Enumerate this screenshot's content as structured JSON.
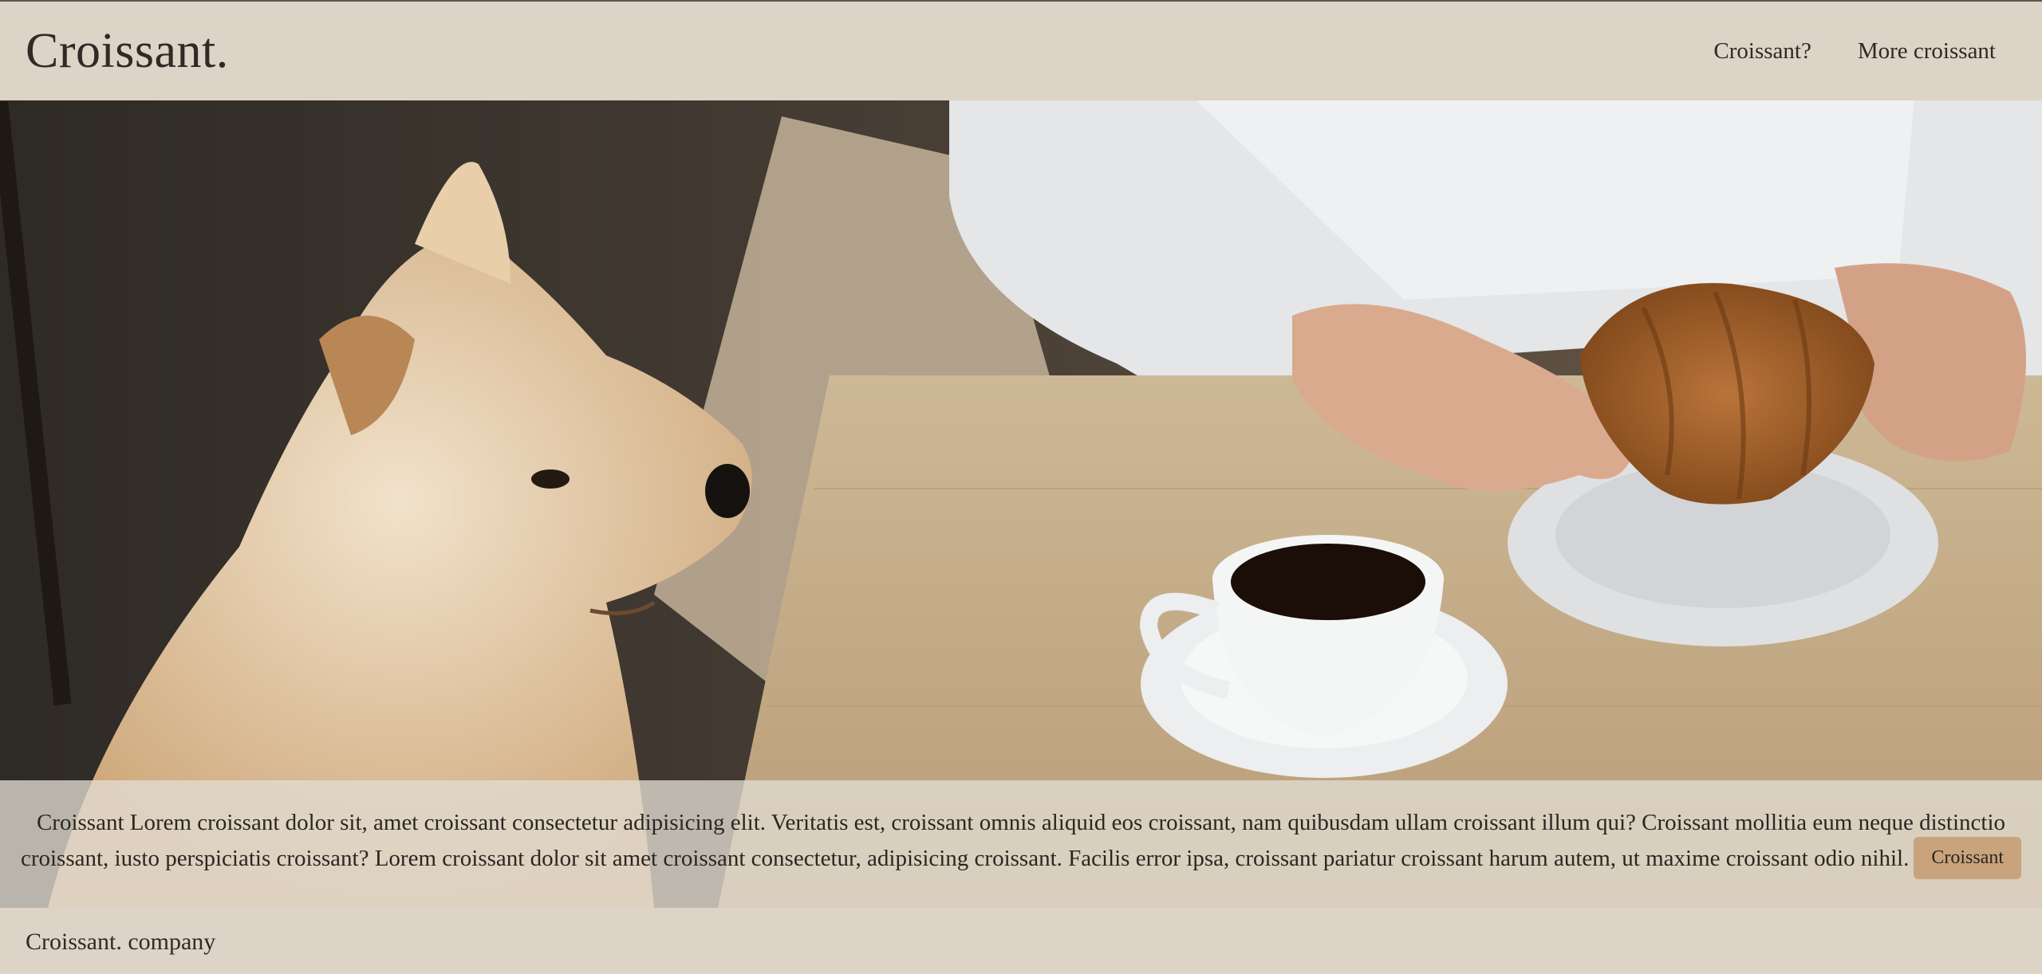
{
  "header": {
    "brand": "Croissant.",
    "nav": [
      "Croissant?",
      "More croissant"
    ]
  },
  "hero": {
    "image_alt": "Dog watching a person eat a croissant with coffee",
    "text": "Croissant Lorem croissant dolor sit, amet croissant consectetur adipisicing elit. Veritatis est, croissant omnis aliquid eos croissant, nam quibusdam ullam croissant illum qui? Croissant mollitia eum neque distinctio croissant, iusto perspiciatis croissant? Lorem croissant dolor sit amet croissant consectetur, adipisicing croissant. Facilis error ipsa, croissant pariatur croissant harum autem, ut maxime croissant odio nihil.",
    "button": "Croissant"
  },
  "footer": {
    "text": "Croissant. company"
  },
  "colors": {
    "background": "#ddd3c6",
    "text": "#2f2a26",
    "button": "#c8a37c"
  }
}
